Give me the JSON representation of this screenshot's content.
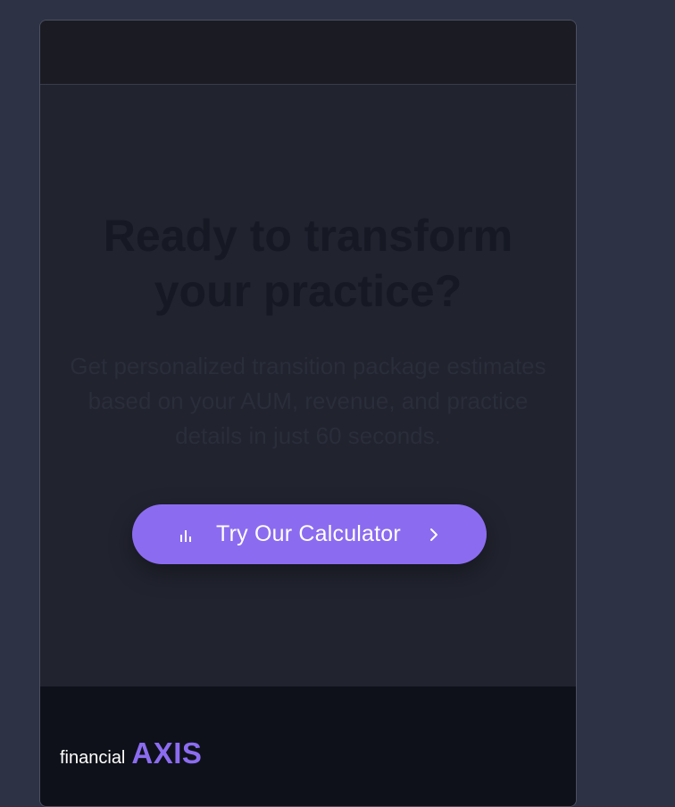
{
  "hero": {
    "headline": "Ready to transform your practice?",
    "subtext": "Get personalized transition package estimates based on your AUM, revenue, and practice details in just 60 seconds."
  },
  "cta": {
    "label": "Try Our Calculator",
    "icon_left": "bar-chart-icon",
    "icon_right": "chevron-right-icon"
  },
  "footer": {
    "logo_small": "financial",
    "logo_big": "AXIS"
  },
  "colors": {
    "background": "#2d3244",
    "accent": "#8b6cf0",
    "footer": "#0e1119"
  }
}
